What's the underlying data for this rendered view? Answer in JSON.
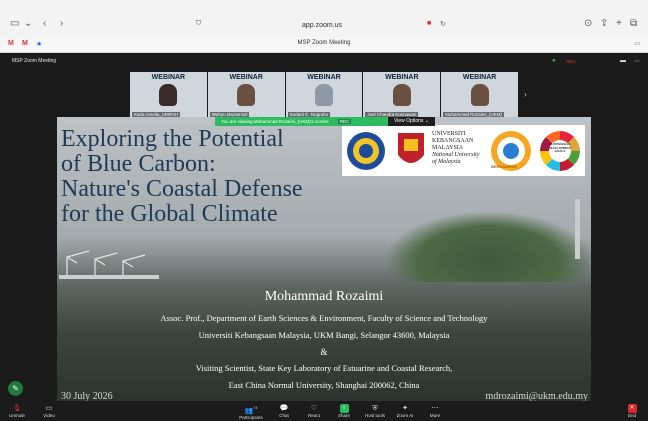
{
  "browser": {
    "url": "app.zoom.us",
    "tab_title": "MSP Zoom Meeting"
  },
  "zoom": {
    "title": "MSP Zoom Meeting",
    "rec_label": "REC",
    "share_banner": "You are viewing  Mohammad Rozaimi_(UKM)'s screen",
    "view_options": "View Options"
  },
  "participants": [
    {
      "name": "Karia Amelia_UMRAH",
      "banner": "WEBINAR"
    },
    {
      "name": "Wahyu Muzammil",
      "banner": "WEBINAR"
    },
    {
      "name": "Sudarti C. Nugroho",
      "banner": "WEBINAR"
    },
    {
      "name": "Joel Chandra Kusnawan",
      "banner": "WEBINAR"
    },
    {
      "name": "Mohammed Rozaimi_(UKM)",
      "banner": "WEBINAR"
    }
  ],
  "slide": {
    "title_lines": [
      "Exploring the Potential",
      "of Blue Carbon:",
      "Nature's Coastal Defense",
      "for the Global Climate"
    ],
    "author": "Mohammad Rozaimi",
    "line1": "Assoc. Prof., Department of Earth Sciences & Environment, Faculty of Science and Technology",
    "line2": "Universiti Kebangsaan Malaysia, UKM Bangi, Selangor 43600, Malaysia",
    "amp": "&",
    "line3": "Visiting Scientist, State Key Laboratory of Estuarine and Coastal Research,",
    "line4": "East China Normal University, Shanghai 200062, China",
    "date": "30 July 2026",
    "email": "mdrozaimi@ukm.edu.my",
    "logo_ukm_lines": [
      "UNIVERSITI",
      "KEBANGSAAN",
      "MALAYSIA",
      "National University",
      "of Malaysia"
    ],
    "logo_ring": "SUSTAINABLE DEVELOPMENT GOALS",
    "logo_emblem_text": "BERDAMPAK"
  },
  "toolbar": [
    {
      "label": "Unmute",
      "icon": "mic-off-icon"
    },
    {
      "label": "Video",
      "icon": "video-icon"
    },
    {
      "label": "Participants",
      "icon": "participants-icon"
    },
    {
      "label": "Chat",
      "icon": "chat-icon"
    },
    {
      "label": "React",
      "icon": "react-icon"
    },
    {
      "label": "Share",
      "icon": "share-icon"
    },
    {
      "label": "Host tools",
      "icon": "host-tools-icon"
    },
    {
      "label": "Zoom AI",
      "icon": "zoom-ai-icon"
    },
    {
      "label": "More",
      "icon": "more-icon"
    },
    {
      "label": "End",
      "icon": "end-icon"
    }
  ],
  "participants_count": "74",
  "colors": {
    "share_green": "#2dbb5d",
    "end_red": "#e02828",
    "title_blue": "#1f3a55"
  }
}
